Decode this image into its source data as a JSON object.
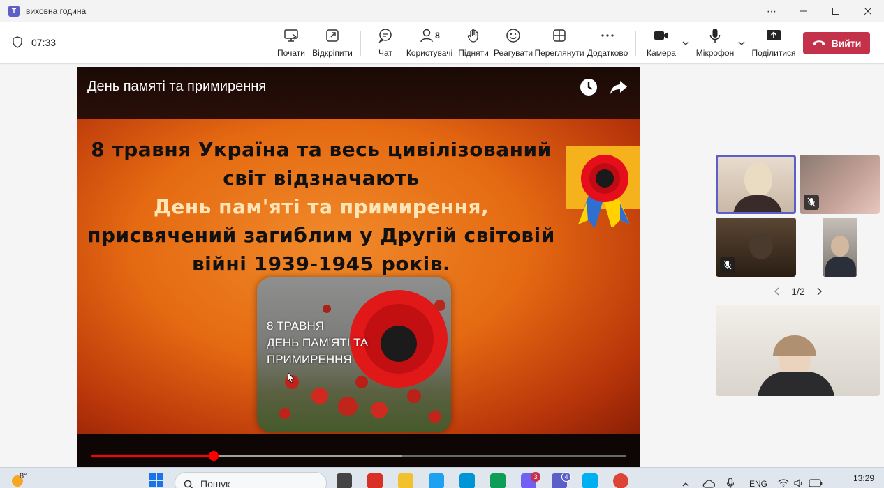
{
  "window": {
    "title": "виховна година",
    "app_icon": "T"
  },
  "toolbar": {
    "timer": "07:33",
    "buttons": {
      "start": "Почати",
      "popout": "Відкріпити",
      "chat": "Чат",
      "people": "Користувачі",
      "people_count": "8",
      "raise": "Підняти",
      "react": "Реагувати",
      "view": "Переглянути",
      "more": "Додатково",
      "camera": "Камера",
      "mic": "Мікрофон",
      "share": "Поділитися",
      "leave": "Вийти"
    }
  },
  "video": {
    "title": "День памяті та примирення",
    "slide_lines": [
      "8 травня Україна та весь цивілізований",
      "світ відзначають",
      "День пам'яті та примирення,",
      "присвячений загиблим у Другій світовій",
      "війні 1939-1945 років."
    ],
    "card_lines": [
      "8 ТРАВНЯ",
      "ДЕНЬ ПАМ'ЯТІ ТА",
      "ПРИМИРЕННЯ"
    ],
    "progress_fraction": 0.229,
    "buffered_fraction": 0.58
  },
  "participants": {
    "pager": "1/2"
  },
  "taskbar": {
    "temperature": "8°",
    "search_label": "Пошук",
    "viber_badge": "3",
    "teams_badge": "4",
    "language": "ENG",
    "time": "13:29"
  },
  "colors": {
    "accent": "#5b5fc7",
    "leave": "#c4314b",
    "progress": "#ff0000"
  }
}
